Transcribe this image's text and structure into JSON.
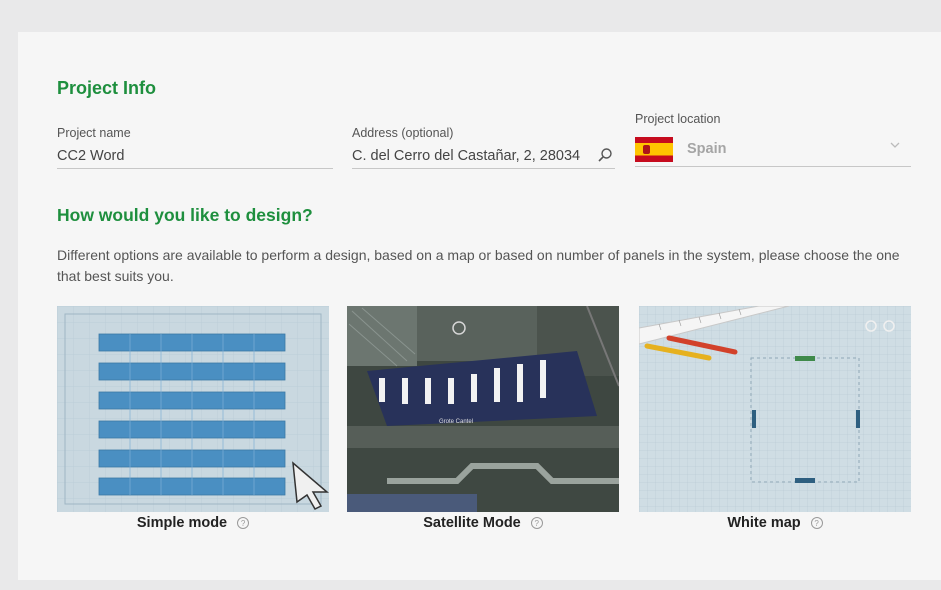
{
  "project_info": {
    "title": "Project Info",
    "name_label": "Project name",
    "name_value": "CC2 Word",
    "address_label": "Address (optional)",
    "address_value": "C. del Cerro del Castañar, 2, 28034",
    "location_label": "Project location",
    "location_value": "Spain"
  },
  "design": {
    "title": "How would you like to design?",
    "description": "Different options are available to perform a design, based on a map or based on number of panels in the system, please choose the one that best suits you.",
    "modes": [
      {
        "label": "Simple mode",
        "help": "?"
      },
      {
        "label": "Satellite Mode",
        "help": "?"
      },
      {
        "label": "White map",
        "help": "?"
      }
    ],
    "satellite_place_text": "Grote Cantel"
  },
  "colors": {
    "accent": "#1e8f3e",
    "panel_blue": "#4a8fc2"
  }
}
